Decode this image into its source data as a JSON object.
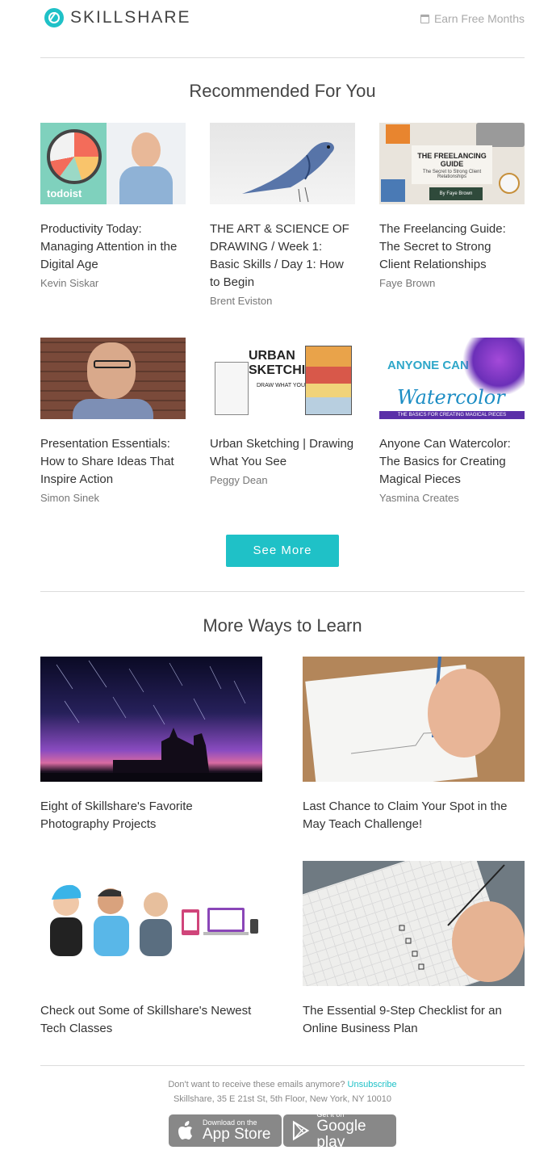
{
  "header": {
    "brand": "SKILLSHARE",
    "earn_label": "Earn Free Months"
  },
  "recommended": {
    "title": "Recommended For You",
    "cards": [
      {
        "title": "Productivity Today: Managing Attention in the Digital Age",
        "author": "Kevin Siskar",
        "thumb_text": "todoist"
      },
      {
        "title": "THE ART & SCIENCE OF DRAWING / Week 1: Basic Skills / Day 1: How to Begin",
        "author": "Brent Eviston"
      },
      {
        "title": "The Freelancing Guide: The Secret to Strong Client Relationships",
        "author": "Faye Brown",
        "thumb_text": "THE FREELANCING GUIDE",
        "thumb_sub": "The Secret to Strong Client Relationships",
        "thumb_foot": "By Faye Brown"
      },
      {
        "title": "Presentation Essentials: How to Share Ideas That Inspire Action",
        "author": "Simon Sinek"
      },
      {
        "title": "Urban Sketching | Drawing What You See",
        "author": "Peggy Dean",
        "thumb_text": "URBAN SKETCHING",
        "thumb_sub": "DRAW WHAT YOU SEE"
      },
      {
        "title": "Anyone Can Watercolor: The Basics for Creating Magical Pieces",
        "author": "Yasmina Creates",
        "thumb_text": "ANYONE CAN",
        "thumb_sub": "Watercolor",
        "thumb_foot": "THE BASICS FOR CREATING MAGICAL PIECES"
      }
    ],
    "see_more_label": "See More"
  },
  "more_ways": {
    "title": "More Ways to Learn",
    "articles": [
      {
        "title": "Eight of Skillshare's Favorite Photography Projects"
      },
      {
        "title": "Last Chance to Claim Your Spot in the May Teach Challenge!"
      },
      {
        "title": "Check out Some of Skillshare's Newest Tech Classes"
      },
      {
        "title": "The Essential 9-Step Checklist for an Online Business Plan"
      }
    ]
  },
  "footer": {
    "unsubscribe_prompt": "Don't want to receive these emails anymore?",
    "unsubscribe_label": "Unsubscribe",
    "address": "Skillshare, 35 E 21st St, 5th Floor, New York, NY 10010",
    "app_store_small": "Download on the",
    "app_store_big": "App Store",
    "google_small": "Get it on",
    "google_big": "Google play"
  },
  "colors": {
    "accent": "#1fc1c7",
    "divider": "#dcdcdc",
    "store_badge": "#888888"
  }
}
